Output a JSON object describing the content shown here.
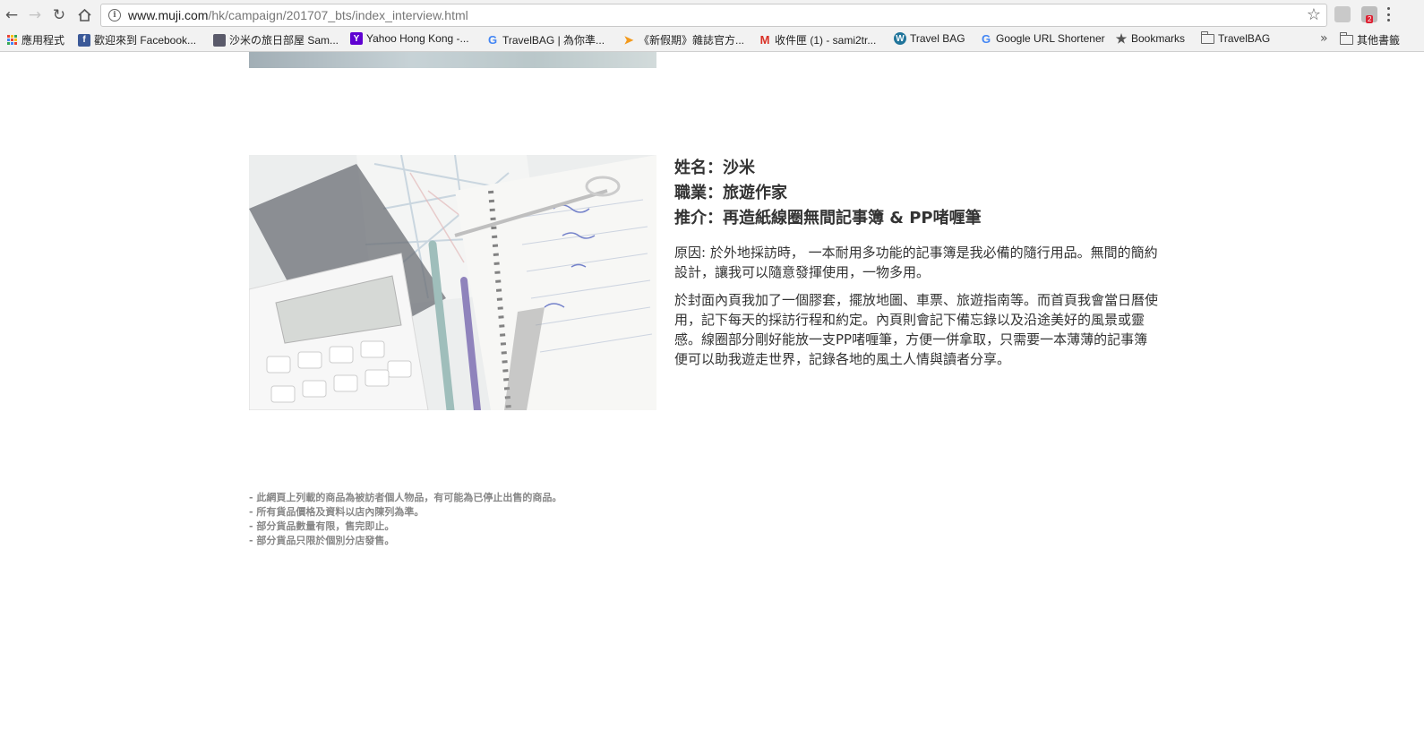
{
  "browser": {
    "url_host": "www.muji.com",
    "url_path": "/hk/campaign/201707_bts/index_interview.html",
    "extension_badge": "2"
  },
  "bookmarks": [
    {
      "label": "應用程式",
      "icon": "apps-grid-icon"
    },
    {
      "label": "歡迎來到 Facebook...",
      "icon": "facebook-icon",
      "color": "#3b5998"
    },
    {
      "label": "沙米の旅日部屋 Sam...",
      "icon": "blog-avatar-icon"
    },
    {
      "label": "Yahoo Hong Kong -...",
      "icon": "yahoo-icon",
      "color": "#5f01d1"
    },
    {
      "label": "TravelBAG | 為你準...",
      "icon": "google-icon"
    },
    {
      "label": "《新假期》雜誌官方...",
      "icon": "paper-plane-icon",
      "color": "#f39a1d"
    },
    {
      "label": "收件匣 (1) - sami2tr...",
      "icon": "gmail-icon",
      "color": "#d93025"
    },
    {
      "label": "Travel BAG",
      "icon": "wordpress-icon",
      "color": "#21759b"
    },
    {
      "label": "Google URL Shortener",
      "icon": "google-icon"
    },
    {
      "label": "Bookmarks",
      "icon": "star-icon"
    },
    {
      "label": "TravelBAG",
      "icon": "folder-icon"
    }
  ],
  "other_bookmarks": "其他書籤",
  "interview": {
    "name_line": "姓名：沙米",
    "job_line": "職業：旅遊作家",
    "recommend_line": "推介：再造紙線圈無間記事簿 & PP啫喱筆",
    "paragraph1": "原因: 於外地採訪時， 一本耐用多功能的記事簿是我必備的隨行用品。無間的簡約設計，讓我可以隨意發揮使用，一物多用。",
    "paragraph2": "於封面內頁我加了一個膠套，擺放地圖、車票、旅遊指南等。而首頁我會當日曆使用，記下每天的採訪行程和約定。內頁則會記下備忘錄以及沿途美好的風景或靈感。線圈部分剛好能放一支PP啫喱筆，方便一併拿取，只需要一本薄薄的記事簿便可以助我遊走世界，記錄各地的風土人情與讀者分享。"
  },
  "notes": [
    "- 此網頁上列載的商品為被訪者個人物品，有可能為已停止出售的商品。",
    "- 所有貨品價格及資料以店內陳列為準。",
    "- 部分貨品數量有限，售完即止。",
    "- 部分貨品只限於個別分店發售。"
  ]
}
